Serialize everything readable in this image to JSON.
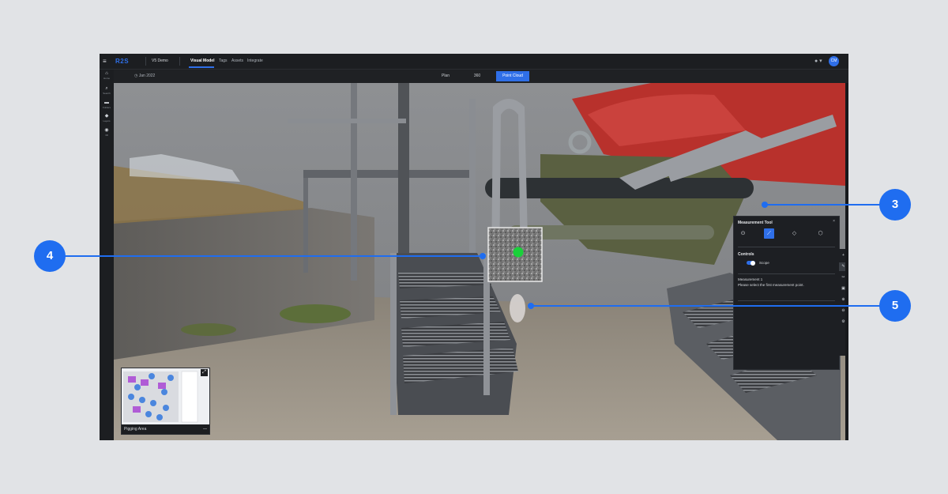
{
  "topbar": {
    "menu_icon": "≡",
    "logo": "R2S",
    "project": "V5 Demo",
    "tabs": [
      {
        "label": "Visual Model",
        "active": true
      },
      {
        "label": "Tags",
        "active": false
      },
      {
        "label": "Assets",
        "active": false
      },
      {
        "label": "Integrate",
        "active": false
      }
    ],
    "help_icon": "● ▾",
    "avatar": "CM"
  },
  "leftnav": {
    "items": [
      {
        "icon": "⌂",
        "label": "Home"
      },
      {
        "icon": "⌕",
        "label": "Search"
      },
      {
        "icon": "▬",
        "label": "Folders"
      },
      {
        "icon": "◆",
        "label": "Layers"
      },
      {
        "icon": "◉",
        "label": "3D"
      }
    ]
  },
  "subbar": {
    "date": "◷ Jan 2022",
    "views": [
      {
        "label": "Plan",
        "active": false
      },
      {
        "label": "360",
        "active": false
      },
      {
        "label": "Point Cloud",
        "active": true
      }
    ]
  },
  "minimap": {
    "caption": "Pigging Area",
    "expand_icon": "⤢",
    "collapse_icon": "—"
  },
  "measurement_panel": {
    "title": "Measurement Tool",
    "close": "×",
    "controls_heading": "Controls",
    "scope_label": "Scope",
    "measurement_name": "Measurement 1",
    "hint": "Please select the first measurement point."
  },
  "callouts": [
    "3",
    "4",
    "5"
  ],
  "colors": {
    "accent": "#2f6fe8",
    "callout": "#1f6df0",
    "point_marker": "#19d13a"
  }
}
